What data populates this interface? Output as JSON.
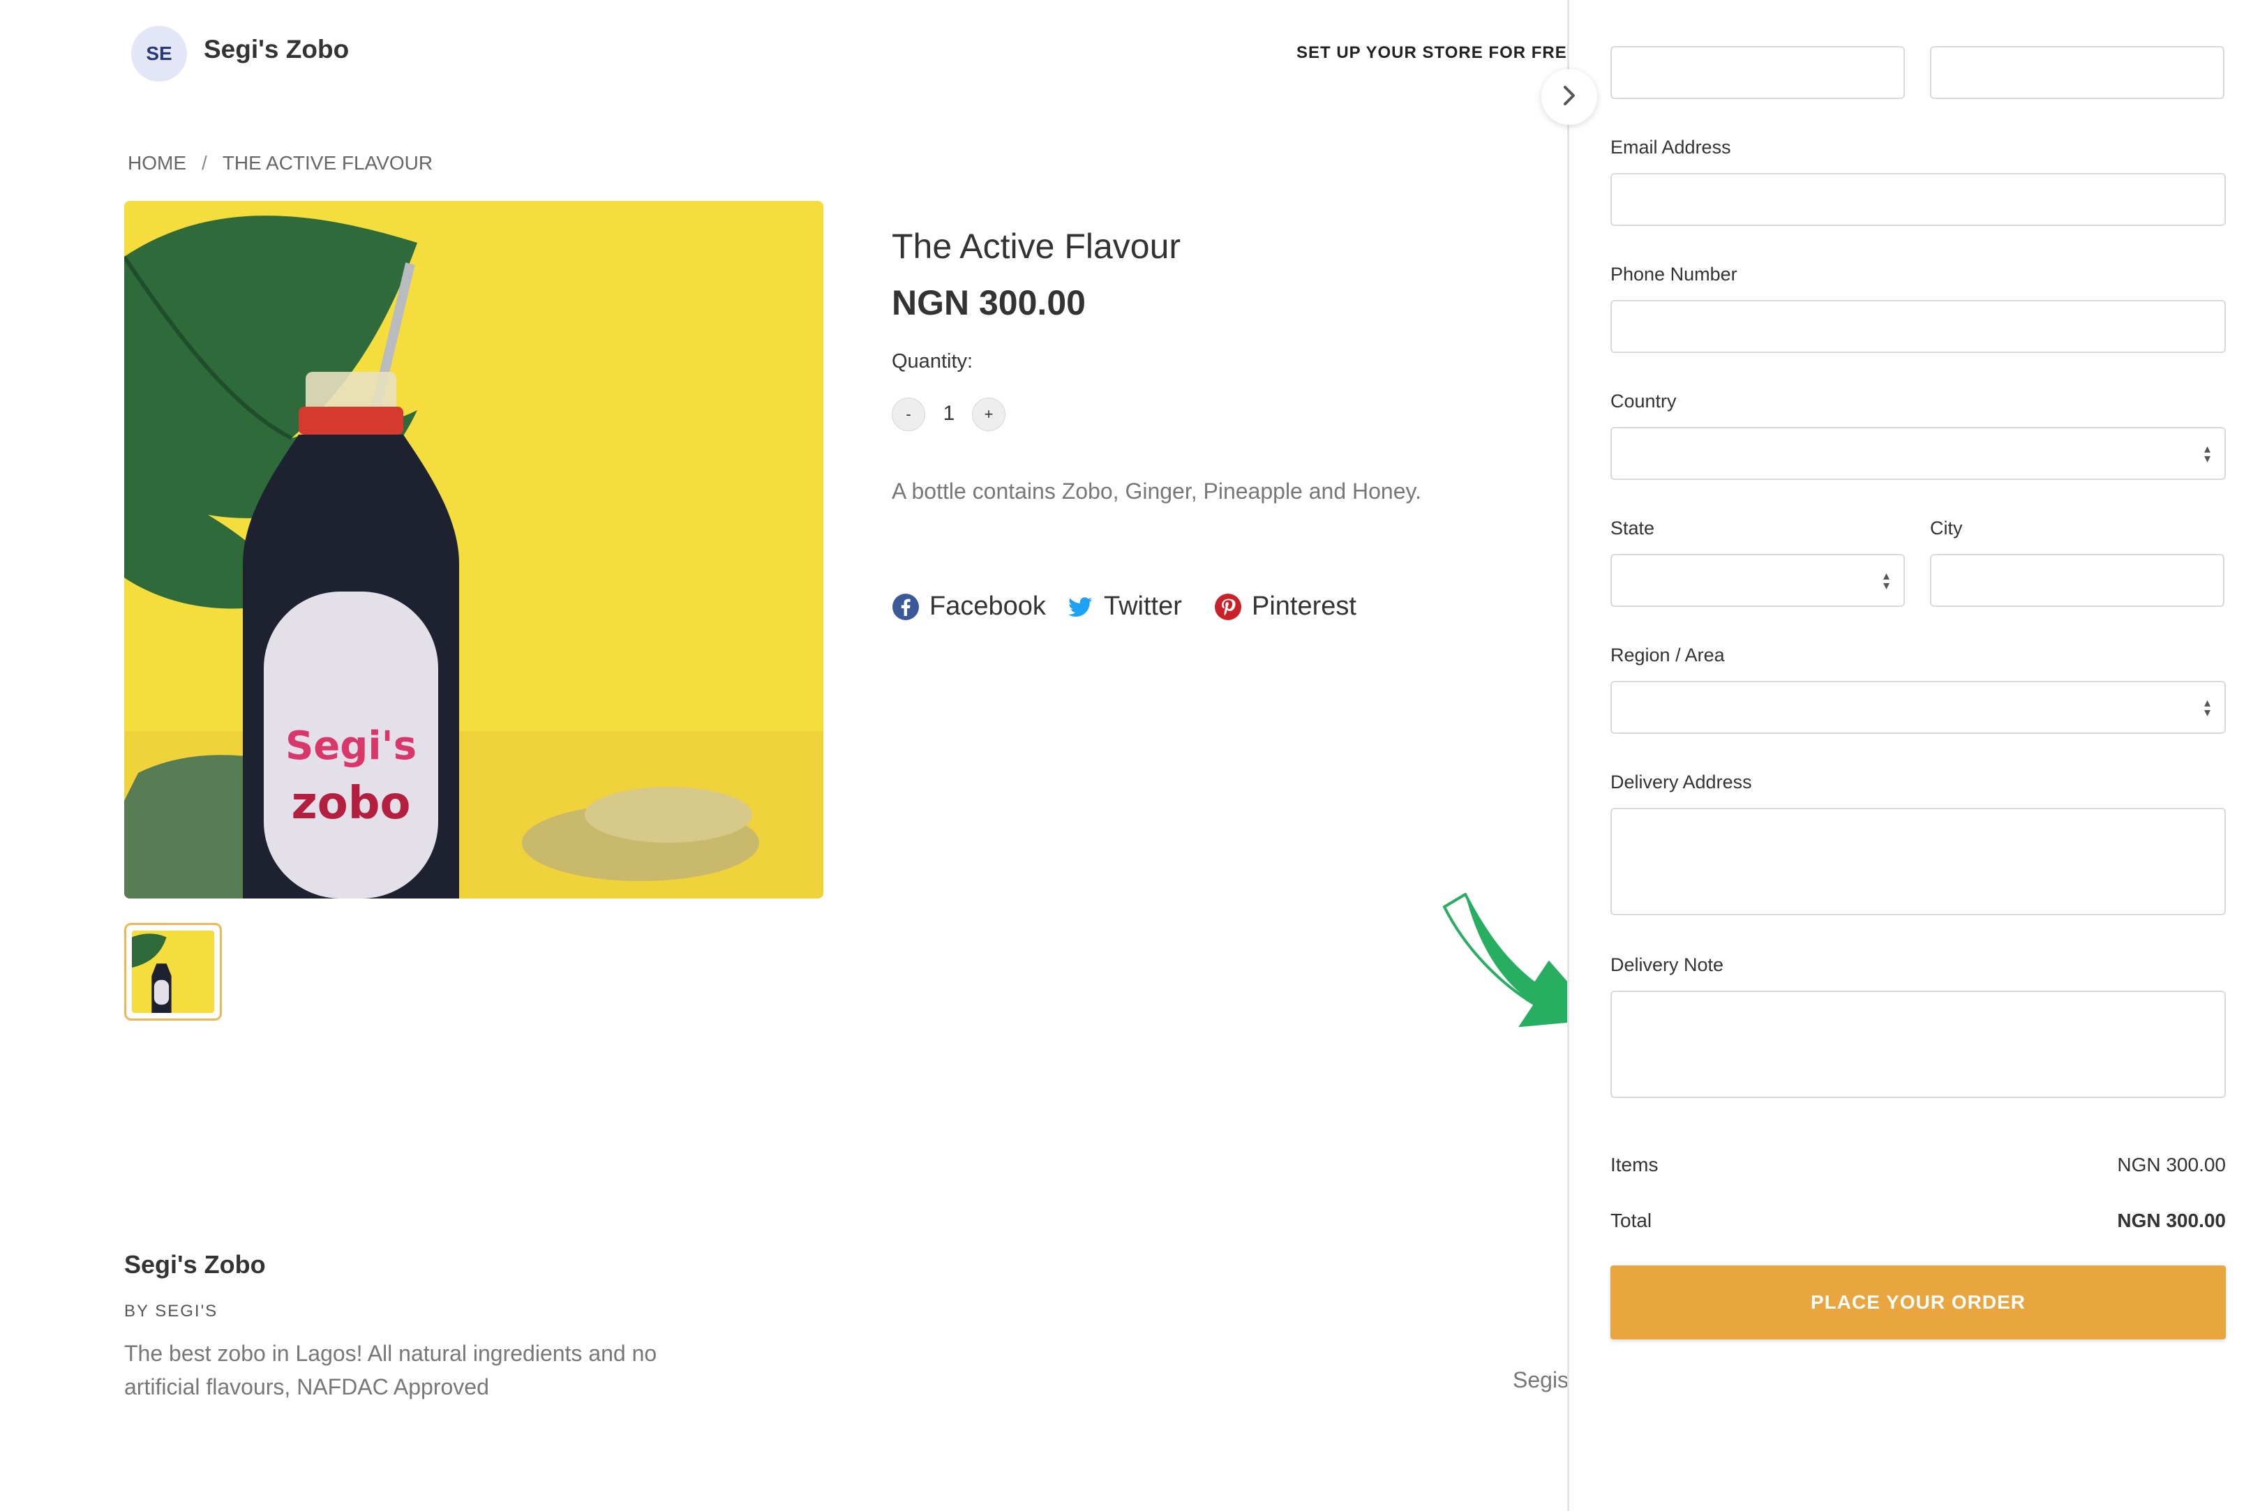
{
  "header": {
    "avatar_initials": "SE",
    "store_name": "Segi's Zobo",
    "setup_link": "SET UP YOUR STORE FOR FREE"
  },
  "breadcrumb": {
    "home": "HOME",
    "separator": "/",
    "current": "THE ACTIVE FLAVOUR"
  },
  "product": {
    "title": "The Active Flavour",
    "price": "NGN 300.00",
    "quantity_label": "Quantity:",
    "quantity": "1",
    "minus": "-",
    "plus": "+",
    "description": "A bottle contains Zobo, Ginger, Pineapple and Honey.",
    "bottle_brand": "Segi's",
    "bottle_name": "zobo"
  },
  "social": {
    "facebook": "Facebook",
    "twitter": "Twitter",
    "pinterest": "Pinterest"
  },
  "footer": {
    "store_name": "Segi's Zobo",
    "by": "BY SEGI'S",
    "description": "The best zobo in Lagos! All natural ingredients and no artificial flavours, NAFDAC Approved",
    "clipped_text": "Segis"
  },
  "checkout": {
    "email_label": "Email Address",
    "phone_label": "Phone Number",
    "country_label": "Country",
    "state_label": "State",
    "city_label": "City",
    "region_label": "Region / Area",
    "address_label": "Delivery Address",
    "note_label": "Delivery Note",
    "items_label": "Items",
    "items_value": "NGN 300.00",
    "total_label": "Total",
    "total_value": "NGN 300.00",
    "order_button": "PLACE YOUR ORDER"
  },
  "colors": {
    "accent": "#e9a63e",
    "avatar_bg": "#e3e6f6",
    "arrow": "#27ae60",
    "facebook": "#3b5998",
    "twitter": "#1da1f2",
    "pinterest": "#cb2027"
  }
}
